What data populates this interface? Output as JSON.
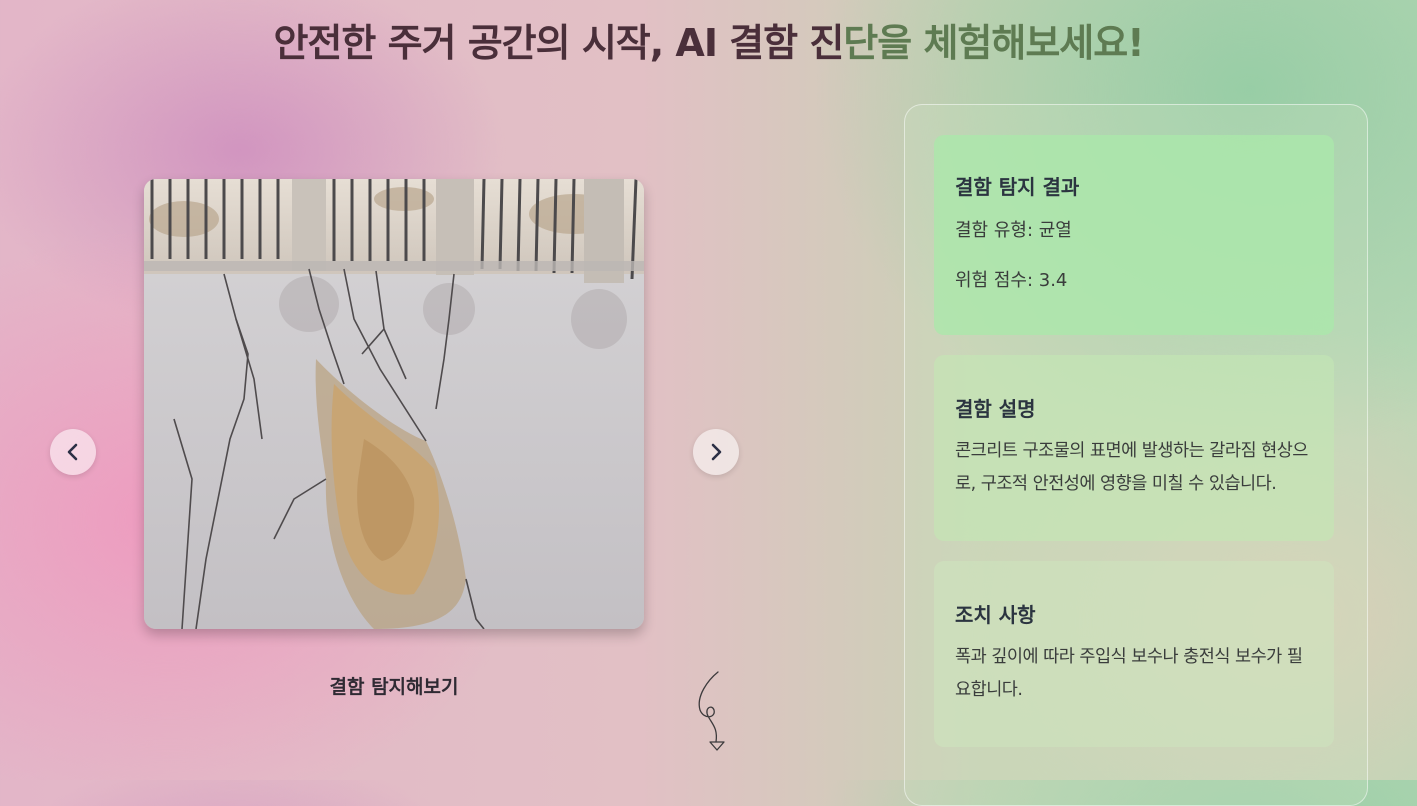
{
  "header": {
    "title_main": "안전한 주거 공간의 시작, AI 결함 진",
    "title_tail": "단을 체험해보세요!"
  },
  "carousel": {
    "image_description": "Cracked asphalt pavement with a pothole in front of a metal fence",
    "prev_icon": "chevron-left-icon",
    "next_icon": "chevron-right-icon",
    "detect_label": "결함 탐지해보기"
  },
  "results": {
    "detection": {
      "title": "결함 탐지 결과",
      "type_line": "결함 유형: 균열",
      "score_line": "위험 점수: 3.4"
    },
    "description": {
      "title": "결함 설명",
      "text": "콘크리트 구조물의 표면에 발생하는 갈라짐 현상으로, 구조적 안전성에 영향을 미칠 수 있습니다."
    },
    "action": {
      "title": "조치 사항",
      "text": "폭과 깊이에 따라 주입식 보수나 충전식 보수가 필요합니다."
    }
  },
  "colors": {
    "title": "#4a2f3a",
    "title_tail": "#5e7b52",
    "card_title": "#2b3440",
    "card_green": "#aae8aa"
  }
}
